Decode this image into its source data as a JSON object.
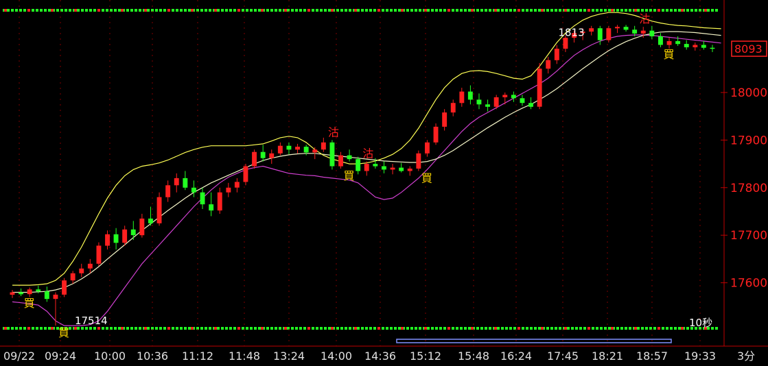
{
  "chart_data": {
    "type": "candlestick",
    "timeframe_label": "3分",
    "countdown_label": "10秒",
    "colors": {
      "background": "#000000",
      "up": "#ff2020",
      "down": "#22ff22",
      "ma_mid": "#f5f5c8",
      "band_upper": "#ffff55",
      "band_lower": "#d040d0",
      "axis": "#c00000",
      "buy_label": "#ffd700"
    },
    "ylim": [
      17500,
      18180
    ],
    "price_ticks": [
      18000,
      17900,
      17800,
      17700,
      17600
    ],
    "last_price_label": "8093",
    "high_label": "1813",
    "low_label": "17514",
    "time_ticks": [
      "09/22",
      "09:24",
      "10:00",
      "10:36",
      "11:12",
      "11:48",
      "13:24",
      "14:00",
      "14:36",
      "15:12",
      "15:48",
      "16:24",
      "17:45",
      "18:21",
      "18:57",
      "19:33"
    ],
    "candles": [
      [
        17575,
        17585,
        17568,
        17580
      ],
      [
        17580,
        17588,
        17572,
        17576
      ],
      [
        17576,
        17590,
        17570,
        17586
      ],
      [
        17586,
        17594,
        17578,
        17582
      ],
      [
        17582,
        17592,
        17560,
        17566
      ],
      [
        17566,
        17580,
        17510,
        17575
      ],
      [
        17575,
        17610,
        17570,
        17605
      ],
      [
        17605,
        17625,
        17598,
        17620
      ],
      [
        17620,
        17640,
        17612,
        17630
      ],
      [
        17630,
        17650,
        17620,
        17640
      ],
      [
        17640,
        17685,
        17635,
        17678
      ],
      [
        17678,
        17710,
        17670,
        17702
      ],
      [
        17702,
        17715,
        17670,
        17684
      ],
      [
        17684,
        17720,
        17678,
        17712
      ],
      [
        17712,
        17730,
        17690,
        17700
      ],
      [
        17700,
        17745,
        17695,
        17735
      ],
      [
        17735,
        17760,
        17720,
        17725
      ],
      [
        17725,
        17790,
        17720,
        17780
      ],
      [
        17780,
        17815,
        17770,
        17805
      ],
      [
        17805,
        17830,
        17790,
        17820
      ],
      [
        17820,
        17835,
        17795,
        17800
      ],
      [
        17800,
        17815,
        17780,
        17790
      ],
      [
        17790,
        17800,
        17755,
        17765
      ],
      [
        17765,
        17790,
        17740,
        17752
      ],
      [
        17752,
        17800,
        17745,
        17790
      ],
      [
        17790,
        17810,
        17780,
        17800
      ],
      [
        17800,
        17820,
        17790,
        17812
      ],
      [
        17812,
        17850,
        17805,
        17845
      ],
      [
        17845,
        17880,
        17840,
        17875
      ],
      [
        17875,
        17890,
        17855,
        17862
      ],
      [
        17862,
        17880,
        17850,
        17872
      ],
      [
        17872,
        17895,
        17868,
        17888
      ],
      [
        17888,
        17895,
        17870,
        17880
      ],
      [
        17880,
        17892,
        17872,
        17886
      ],
      [
        17886,
        17890,
        17868,
        17874
      ],
      [
        17874,
        17885,
        17860,
        17880
      ],
      [
        17880,
        17905,
        17875,
        17895
      ],
      [
        17895,
        17900,
        17838,
        17845
      ],
      [
        17845,
        17875,
        17840,
        17868
      ],
      [
        17868,
        17880,
        17855,
        17860
      ],
      [
        17860,
        17865,
        17828,
        17835
      ],
      [
        17835,
        17855,
        17825,
        17850
      ],
      [
        17850,
        17862,
        17840,
        17845
      ],
      [
        17845,
        17855,
        17830,
        17838
      ],
      [
        17838,
        17850,
        17828,
        17842
      ],
      [
        17842,
        17852,
        17832,
        17835
      ],
      [
        17835,
        17845,
        17825,
        17840
      ],
      [
        17840,
        17878,
        17835,
        17872
      ],
      [
        17872,
        17900,
        17865,
        17895
      ],
      [
        17895,
        17935,
        17890,
        17928
      ],
      [
        17928,
        17965,
        17920,
        17958
      ],
      [
        17958,
        17985,
        17950,
        17978
      ],
      [
        17978,
        18010,
        17970,
        18002
      ],
      [
        18002,
        18015,
        17975,
        17985
      ],
      [
        17985,
        17998,
        17965,
        17975
      ],
      [
        17975,
        17985,
        17960,
        17970
      ],
      [
        17970,
        17995,
        17965,
        17990
      ],
      [
        17990,
        18000,
        17975,
        17995
      ],
      [
        17995,
        18002,
        17980,
        17988
      ],
      [
        17988,
        17995,
        17972,
        17978
      ],
      [
        17978,
        17990,
        17965,
        17970
      ],
      [
        17970,
        18062,
        17965,
        18050
      ],
      [
        18050,
        18075,
        18040,
        18068
      ],
      [
        18068,
        18100,
        18060,
        18092
      ],
      [
        18092,
        18120,
        18085,
        18115
      ],
      [
        18115,
        18130,
        18105,
        18125
      ],
      [
        18125,
        18135,
        18110,
        18128
      ],
      [
        18128,
        18140,
        18120,
        18135
      ],
      [
        18135,
        18140,
        18100,
        18110
      ],
      [
        18110,
        18140,
        18105,
        18135
      ],
      [
        18135,
        18142,
        18125,
        18138
      ],
      [
        18138,
        18142,
        18128,
        18132
      ],
      [
        18132,
        18140,
        18118,
        18124
      ],
      [
        18124,
        18138,
        18115,
        18130
      ],
      [
        18130,
        18140,
        18112,
        18118
      ],
      [
        18118,
        18125,
        18095,
        18100
      ],
      [
        18100,
        18115,
        18092,
        18108
      ],
      [
        18108,
        18118,
        18098,
        18102
      ],
      [
        18102,
        18110,
        18090,
        18095
      ],
      [
        18095,
        18105,
        18088,
        18100
      ],
      [
        18100,
        18108,
        18090,
        18094
      ],
      [
        18094,
        18100,
        18085,
        18092
      ]
    ],
    "ma_mid": [
      17580,
      17580,
      17580,
      17581,
      17582,
      17585,
      17590,
      17598,
      17608,
      17620,
      17634,
      17650,
      17665,
      17680,
      17695,
      17710,
      17724,
      17738,
      17752,
      17765,
      17778,
      17790,
      17800,
      17810,
      17818,
      17826,
      17834,
      17842,
      17850,
      17857,
      17862,
      17866,
      17869,
      17871,
      17872,
      17872,
      17870,
      17868,
      17866,
      17864,
      17862,
      17860,
      17858,
      17856,
      17855,
      17854,
      17853,
      17853,
      17855,
      17860,
      17868,
      17878,
      17890,
      17902,
      17914,
      17926,
      17937,
      17948,
      17958,
      17967,
      17975,
      17985,
      17996,
      18008,
      18022,
      18036,
      18050,
      18063,
      18076,
      18088,
      18098,
      18107,
      18114,
      18120,
      18124,
      18127,
      18128,
      18128,
      18127,
      18126,
      18124,
      18122,
      18120
    ],
    "band_upper": [
      17595,
      17595,
      17595,
      17596,
      17598,
      17605,
      17620,
      17645,
      17675,
      17710,
      17745,
      17778,
      17805,
      17825,
      17838,
      17845,
      17848,
      17852,
      17858,
      17866,
      17874,
      17880,
      17885,
      17888,
      17888,
      17888,
      17888,
      17888,
      17890,
      17892,
      17898,
      17905,
      17908,
      17905,
      17895,
      17880,
      17868,
      17860,
      17855,
      17850,
      17850,
      17852,
      17856,
      17862,
      17870,
      17882,
      17900,
      17925,
      17955,
      17985,
      18010,
      18028,
      18040,
      18045,
      18046,
      18044,
      18040,
      18035,
      18030,
      18028,
      18035,
      18055,
      18080,
      18105,
      18125,
      18140,
      18152,
      18160,
      18165,
      18168,
      18168,
      18166,
      18162,
      18156,
      18150,
      18146,
      18143,
      18141,
      18140,
      18138,
      18136,
      18135,
      18134
    ],
    "band_lower": [
      17560,
      17558,
      17556,
      17553,
      17540,
      17520,
      17510,
      17510,
      17510,
      17512,
      17520,
      17540,
      17565,
      17590,
      17615,
      17640,
      17660,
      17680,
      17700,
      17720,
      17740,
      17760,
      17778,
      17795,
      17810,
      17822,
      17830,
      17838,
      17842,
      17845,
      17840,
      17835,
      17830,
      17828,
      17826,
      17825,
      17822,
      17820,
      17818,
      17816,
      17810,
      17795,
      17780,
      17775,
      17778,
      17790,
      17805,
      17820,
      17838,
      17858,
      17878,
      17898,
      17918,
      17935,
      17948,
      17958,
      17968,
      17978,
      17988,
      17998,
      18008,
      18018,
      18030,
      18045,
      18062,
      18078,
      18090,
      18100,
      18108,
      18114,
      18118,
      18120,
      18121,
      18121,
      18120,
      18118,
      18116,
      18114,
      18112,
      18110,
      18108,
      18106,
      18104
    ],
    "buy_signals": [
      {
        "index": 1,
        "label": "買"
      },
      {
        "index": 5,
        "label": "買"
      },
      {
        "index": 38,
        "label": "買"
      },
      {
        "index": 47,
        "label": "買"
      },
      {
        "index": 75,
        "label": "買"
      }
    ],
    "sell_signals": [
      {
        "index": 37,
        "label": "沽"
      },
      {
        "index": 41,
        "label": "沽"
      },
      {
        "index": 73,
        "label": "沽"
      }
    ]
  }
}
